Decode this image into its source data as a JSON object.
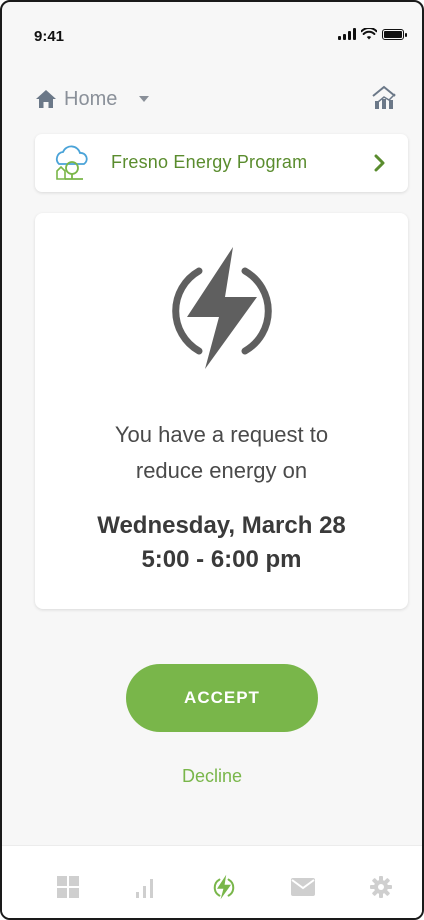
{
  "status_bar": {
    "time": "9:41"
  },
  "top_nav": {
    "location_label": "Home"
  },
  "program": {
    "name": "Fresno Energy Program"
  },
  "request": {
    "line1": "You have a request to",
    "line2": "reduce energy on",
    "date": "Wednesday, March 28",
    "time_range": "5:00 - 6:00 pm"
  },
  "actions": {
    "accept_label": "ACCEPT",
    "decline_label": "Decline"
  },
  "colors": {
    "accent_green": "#79b64a",
    "program_green": "#5a8c2e",
    "icon_gray": "#5f5f5f",
    "tab_gray": "#cfcfcf"
  },
  "tab_bar": {
    "tabs": [
      {
        "icon": "grid-icon",
        "active": false
      },
      {
        "icon": "bar-chart-icon",
        "active": false
      },
      {
        "icon": "lightning-icon",
        "active": true
      },
      {
        "icon": "mail-icon",
        "active": false
      },
      {
        "icon": "gear-icon",
        "active": false
      }
    ]
  }
}
